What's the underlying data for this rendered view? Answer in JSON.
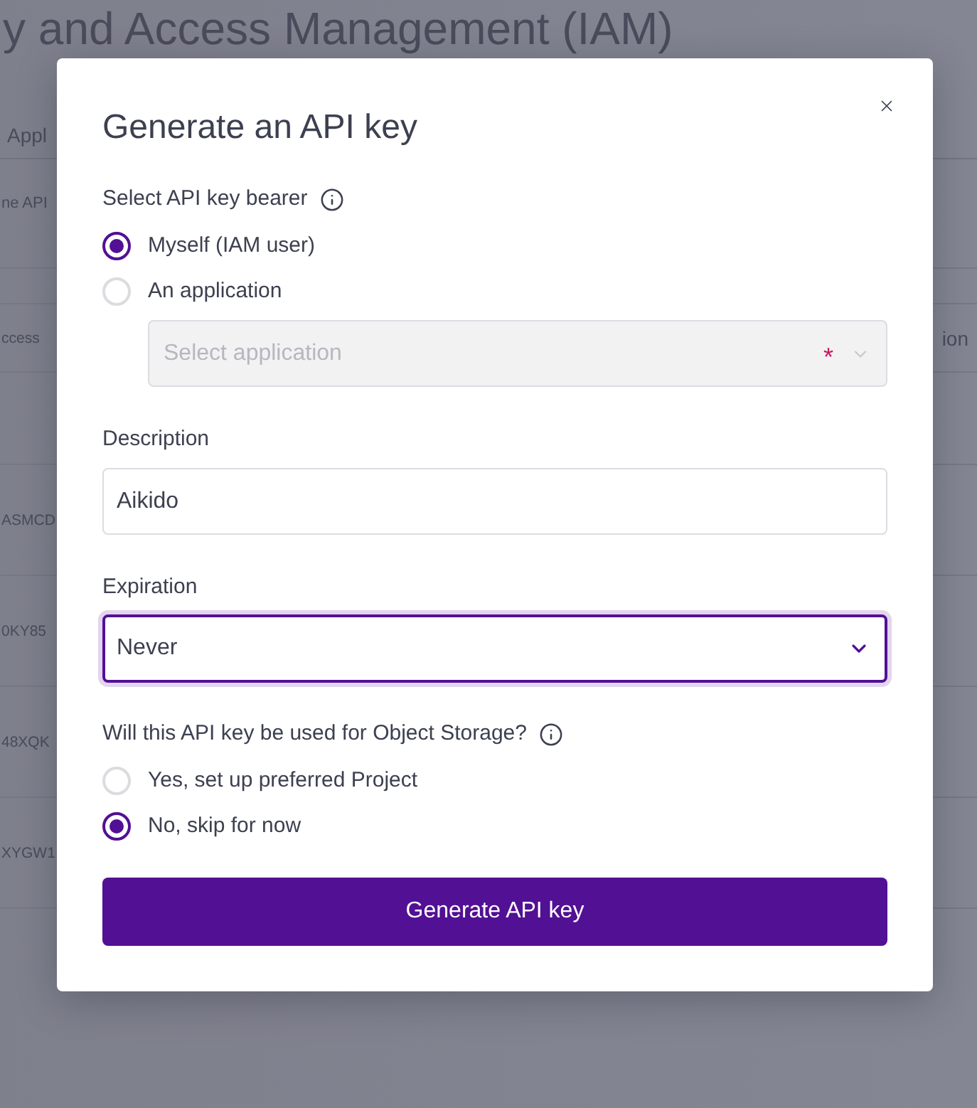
{
  "background": {
    "title": "y and Access Management (IAM)",
    "tab": "Appl",
    "description": "ne API",
    "table": {
      "column_1": "ccess",
      "column_2": "ion",
      "rows": [
        {
          "column_1": "ASMCD"
        },
        {
          "column_1": "0KY85"
        },
        {
          "column_1": "48XQK"
        },
        {
          "column_1": "XYGW1"
        }
      ]
    }
  },
  "dialog": {
    "title": "Generate an API key",
    "bearer": {
      "label": "Select API key bearer",
      "options": [
        {
          "label": "Myself (IAM user)",
          "selected": true
        },
        {
          "label": "An application",
          "selected": false
        }
      ],
      "application_select": {
        "placeholder": "Select application",
        "required_mark": "*",
        "disabled": true
      }
    },
    "description": {
      "label": "Description",
      "value": "Aikido"
    },
    "expiration": {
      "label": "Expiration",
      "value": "Never",
      "focused": true
    },
    "object_storage": {
      "label": "Will this API key be used for Object Storage?",
      "options": [
        {
          "label": "Yes, set up preferred Project",
          "selected": false
        },
        {
          "label": "No, skip for now",
          "selected": true
        }
      ]
    },
    "submit_button": {
      "label": "Generate API key"
    }
  }
}
